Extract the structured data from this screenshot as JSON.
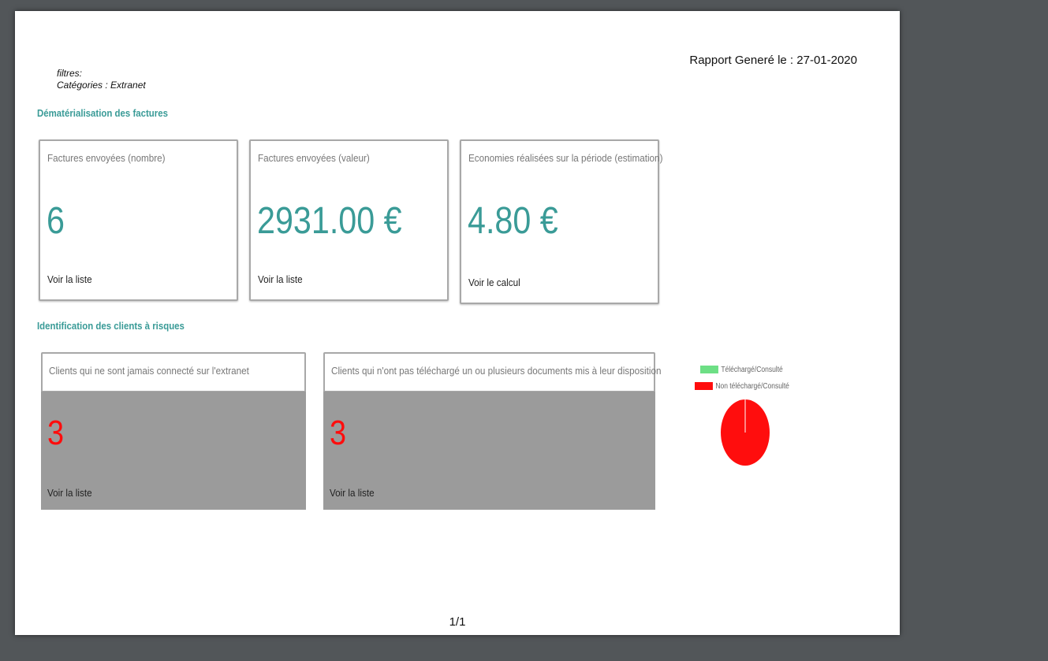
{
  "report": {
    "generated_label": "Rapport Generé le : 27-01-2020",
    "filters_label": "filtres:",
    "filters_value": "Catégories : Extranet",
    "page_number": "1/1"
  },
  "sections": {
    "dematerialisation_title": "Dématérialisation des factures",
    "risks_title": "Identification des clients à risques"
  },
  "kpi_cards": [
    {
      "title": "Factures envoyées (nombre)",
      "value": "6",
      "link": "Voir la liste"
    },
    {
      "title": "Factures envoyées (valeur)",
      "value": "2931.00 €",
      "link": "Voir la liste"
    },
    {
      "title": "Economies réalisées sur la période (estimation)",
      "value": "4.80 €",
      "link": "Voir le calcul"
    }
  ],
  "risk_cards": [
    {
      "title": "Clients qui ne sont jamais connecté sur l'extranet",
      "value": "3",
      "link": "Voir la liste"
    },
    {
      "title": "Clients qui n'ont pas téléchargé un ou plusieurs documents mis à leur disposition",
      "value": "3",
      "link": "Voir la liste"
    }
  ],
  "colors": {
    "accent": "#3a9b97",
    "risk_value": "#ff0d0d",
    "risk_bg": "#9b9b9b",
    "viewer_bg": "#525659"
  },
  "chart_data": {
    "type": "pie",
    "title": "",
    "legend_position": "top",
    "slices": [
      {
        "label": "Téléchargé/Consulté",
        "value": 0,
        "color": "#6ddf85"
      },
      {
        "label": "Non téléchargé/Consulté",
        "value": 100,
        "color": "#ff0d0d"
      }
    ]
  }
}
